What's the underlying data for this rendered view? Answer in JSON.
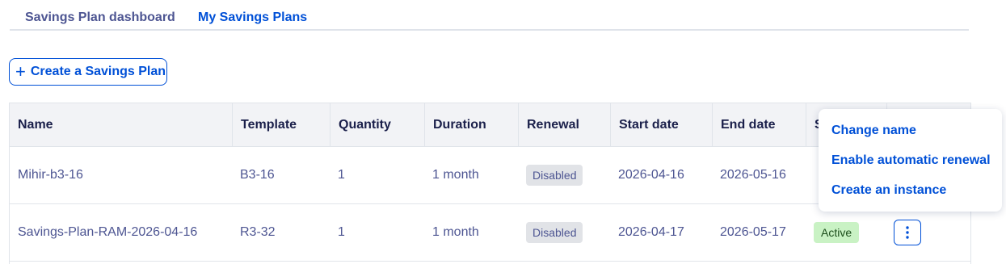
{
  "tabs": [
    {
      "label": "Savings Plan dashboard",
      "active": false
    },
    {
      "label": "My Savings Plans",
      "active": true
    }
  ],
  "create_button": {
    "label": "Create a Savings Plan",
    "icon": "plus-icon"
  },
  "table": {
    "columns": [
      "Name",
      "Template",
      "Quantity",
      "Duration",
      "Renewal",
      "Start date",
      "End date",
      "S",
      ""
    ],
    "rows": [
      {
        "name": "Mihir-b3-16",
        "template": "B3-16",
        "quantity": "1",
        "duration": "1 month",
        "renewal": "Disabled",
        "start_date": "2026-04-16",
        "end_date": "2026-05-16",
        "status": ""
      },
      {
        "name": "Savings-Plan-RAM-2026-04-16",
        "template": "R3-32",
        "quantity": "1",
        "duration": "1 month",
        "renewal": "Disabled",
        "start_date": "2026-04-17",
        "end_date": "2026-05-17",
        "status": "Active"
      }
    ]
  },
  "context_menu": {
    "items": [
      "Change name",
      "Enable automatic renewal",
      "Create an instance"
    ]
  },
  "colors": {
    "accent": "#0050d7",
    "text": "#4d5592",
    "header_bg": "#f2f3f6",
    "active_badge_bg": "#c9f2c4",
    "disabled_badge_bg": "#e1e3e7"
  }
}
